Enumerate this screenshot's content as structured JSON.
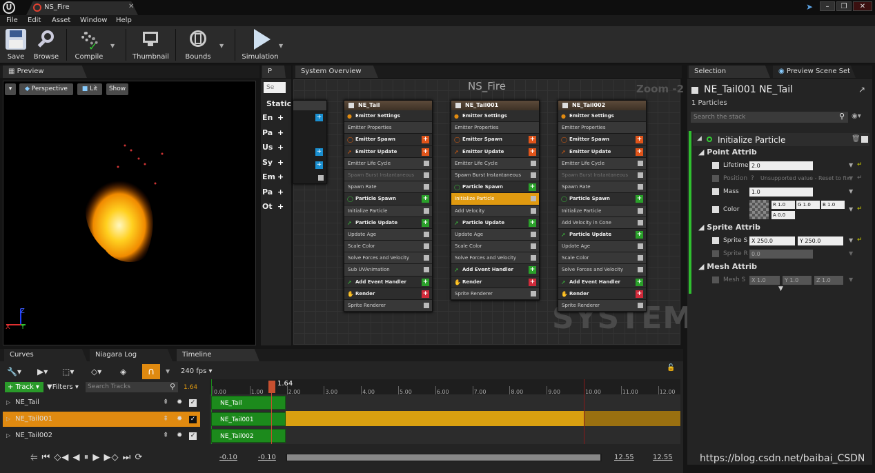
{
  "titlebar": {
    "asset_tab": "NS_Fire"
  },
  "menu": [
    "File",
    "Edit",
    "Asset",
    "Window",
    "Help"
  ],
  "toolbar": {
    "save": "Save",
    "browse": "Browse",
    "compile": "Compile",
    "thumbnail": "Thumbnail",
    "bounds": "Bounds",
    "simulation": "Simulation"
  },
  "preview": {
    "tab": "Preview",
    "perspective": "Perspective",
    "lit": "Lit",
    "show": "Show",
    "axis_x": "X",
    "axis_y": "Y",
    "axis_z": "Z"
  },
  "params": {
    "tab": "P",
    "search_placeholder": "Se",
    "header": "Static",
    "items": [
      "En",
      "Pa",
      "Us",
      "Sy",
      "Em",
      "Pa",
      "Ot"
    ]
  },
  "graph": {
    "tab": "System Overview",
    "title": "NS_Fire",
    "zoom": "Zoom -2",
    "watermark": "SYSTEM",
    "nodes": [
      {
        "name": "NE_Tail",
        "rows": [
          {
            "t": "Emitter Settings",
            "k": "grp",
            "ic": "orange"
          },
          {
            "t": "Emitter Properties",
            "k": "mod"
          },
          {
            "t": "Emitter Spawn",
            "k": "grp",
            "ic": "ring",
            "p": "orange"
          },
          {
            "t": "Emitter Update",
            "k": "grp",
            "ic": "arrow",
            "p": "orange"
          },
          {
            "t": "Emitter Life Cycle",
            "k": "mod",
            "c": 1
          },
          {
            "t": "Spawn Burst Instantaneous",
            "k": "mod dis",
            "c": 1
          },
          {
            "t": "Spawn Rate",
            "k": "mod",
            "c": 1
          },
          {
            "t": "Particle Spawn",
            "k": "grp",
            "ic": "ringg",
            "p": "green"
          },
          {
            "t": "Initialize Particle",
            "k": "mod",
            "c": 1
          },
          {
            "t": "Particle Update",
            "k": "grp",
            "ic": "arrowg",
            "p": "green"
          },
          {
            "t": "Update Age",
            "k": "mod",
            "c": 1
          },
          {
            "t": "Scale Color",
            "k": "mod",
            "c": 1
          },
          {
            "t": "Solve Forces and Velocity",
            "k": "mod",
            "c": 1
          },
          {
            "t": "Sub UVAnimation",
            "k": "mod",
            "c": 1
          },
          {
            "t": "Add Event Handler",
            "k": "grp",
            "ic": "arrowg",
            "p": "green"
          },
          {
            "t": "Render",
            "k": "grp",
            "ic": "red",
            "p": "red"
          },
          {
            "t": "Sprite Renderer",
            "k": "mod",
            "c": 1
          }
        ]
      },
      {
        "name": "NE_Tail001",
        "rows": [
          {
            "t": "Emitter Settings",
            "k": "grp",
            "ic": "orange"
          },
          {
            "t": "Emitter Properties",
            "k": "mod"
          },
          {
            "t": "Emitter Spawn",
            "k": "grp",
            "ic": "ring",
            "p": "orange"
          },
          {
            "t": "Emitter Update",
            "k": "grp",
            "ic": "arrow",
            "p": "orange"
          },
          {
            "t": "Emitter Life Cycle",
            "k": "mod",
            "c": 1
          },
          {
            "t": "Spawn Burst Instantaneous",
            "k": "mod",
            "c": 1
          },
          {
            "t": "Particle Spawn",
            "k": "grp",
            "ic": "ringg",
            "p": "green"
          },
          {
            "t": "Initialize Particle",
            "k": "sel",
            "c": 1
          },
          {
            "t": "Add Velocity",
            "k": "mod",
            "c": 1
          },
          {
            "t": "Particle Update",
            "k": "grp",
            "ic": "arrowg",
            "p": "green"
          },
          {
            "t": "Update Age",
            "k": "mod",
            "c": 1
          },
          {
            "t": "Scale Color",
            "k": "mod",
            "c": 1
          },
          {
            "t": "Solve Forces and Velocity",
            "k": "mod",
            "c": 1
          },
          {
            "t": "Add Event Handler",
            "k": "grp",
            "ic": "arrowg",
            "p": "green"
          },
          {
            "t": "Render",
            "k": "grp",
            "ic": "red",
            "p": "red"
          },
          {
            "t": "Sprite Renderer",
            "k": "mod",
            "c": 1
          }
        ]
      },
      {
        "name": "NE_Tail002",
        "rows": [
          {
            "t": "Emitter Settings",
            "k": "grp",
            "ic": "orange"
          },
          {
            "t": "Emitter Properties",
            "k": "mod"
          },
          {
            "t": "Emitter Spawn",
            "k": "grp",
            "ic": "ring",
            "p": "orange"
          },
          {
            "t": "Emitter Update",
            "k": "grp",
            "ic": "arrow",
            "p": "orange"
          },
          {
            "t": "Emitter Life Cycle",
            "k": "mod",
            "c": 1
          },
          {
            "t": "Spawn Burst Instantaneous",
            "k": "mod dis",
            "c": 1
          },
          {
            "t": "Spawn Rate",
            "k": "mod",
            "c": 1
          },
          {
            "t": "Particle Spawn",
            "k": "grp",
            "ic": "ringg",
            "p": "green"
          },
          {
            "t": "Initialize Particle",
            "k": "mod",
            "c": 1
          },
          {
            "t": "Add Velocity in Cone",
            "k": "mod",
            "c": 1
          },
          {
            "t": "Particle Update",
            "k": "grp",
            "ic": "arrowg",
            "p": "green"
          },
          {
            "t": "Update Age",
            "k": "mod",
            "c": 1
          },
          {
            "t": "Scale Color",
            "k": "mod",
            "c": 1
          },
          {
            "t": "Solve Forces and Velocity",
            "k": "mod",
            "c": 1
          },
          {
            "t": "Add Event Handler",
            "k": "grp",
            "ic": "arrowg",
            "p": "green"
          },
          {
            "t": "Render",
            "k": "grp",
            "ic": "red",
            "p": "red"
          },
          {
            "t": "Sprite Renderer",
            "k": "mod",
            "c": 1
          }
        ]
      }
    ]
  },
  "selection": {
    "tab": "Selection",
    "tab2": "Preview Scene Set",
    "title": "NE_Tail001  NE_Tail",
    "count": "1 Particles",
    "search_placeholder": "Search the stack",
    "module": "Initialize Particle",
    "point_header": "Point Attrib",
    "lifetime_label": "Lifetime",
    "lifetime_value": "2.0",
    "position_label": "Position",
    "position_value": "Unsupported value - Reset to fix",
    "mass_label": "Mass",
    "mass_value": "1.0",
    "color_label": "Color",
    "color_r": "R  1.0",
    "color_g": "G  1.0",
    "color_b": "B  1.0",
    "color_a": "A  0.0",
    "sprite_header": "Sprite Attrib",
    "sprite_size_label": "Sprite S",
    "sprite_x": "X  250.0",
    "sprite_y": "Y  250.0",
    "sprite_rot_label": "Sprite R",
    "sprite_rot_value": "0.0",
    "mesh_header": "Mesh Attrib",
    "mesh_label": "Mesh S",
    "mesh_x": "X  1.0",
    "mesh_y": "Y  1.0",
    "mesh_z": "Z  1.0"
  },
  "bottom_tabs": [
    "Curves",
    "Niagara Log",
    "Timeline"
  ],
  "timeline": {
    "fps": "240 fps",
    "add_track": "Track",
    "filters": "Filters",
    "search_placeholder": "Search Tracks",
    "current_time": "1.64",
    "playhead_label": "1.64",
    "tracks": [
      "NE_Tail",
      "NE_Tail001",
      "NE_Tail002"
    ],
    "ruler": [
      "0.00",
      "1.00",
      "2.00",
      "3.00",
      "4.00",
      "5.00",
      "6.00",
      "7.00",
      "8.00",
      "9.00",
      "10.00",
      "11.00",
      "12.00"
    ],
    "range_start_a": "-0.10",
    "range_start_b": "-0.10",
    "range_end_a": "12.55",
    "range_end_b": "12.55"
  },
  "watermark": "https://blog.csdn.net/baibai_CSDN"
}
